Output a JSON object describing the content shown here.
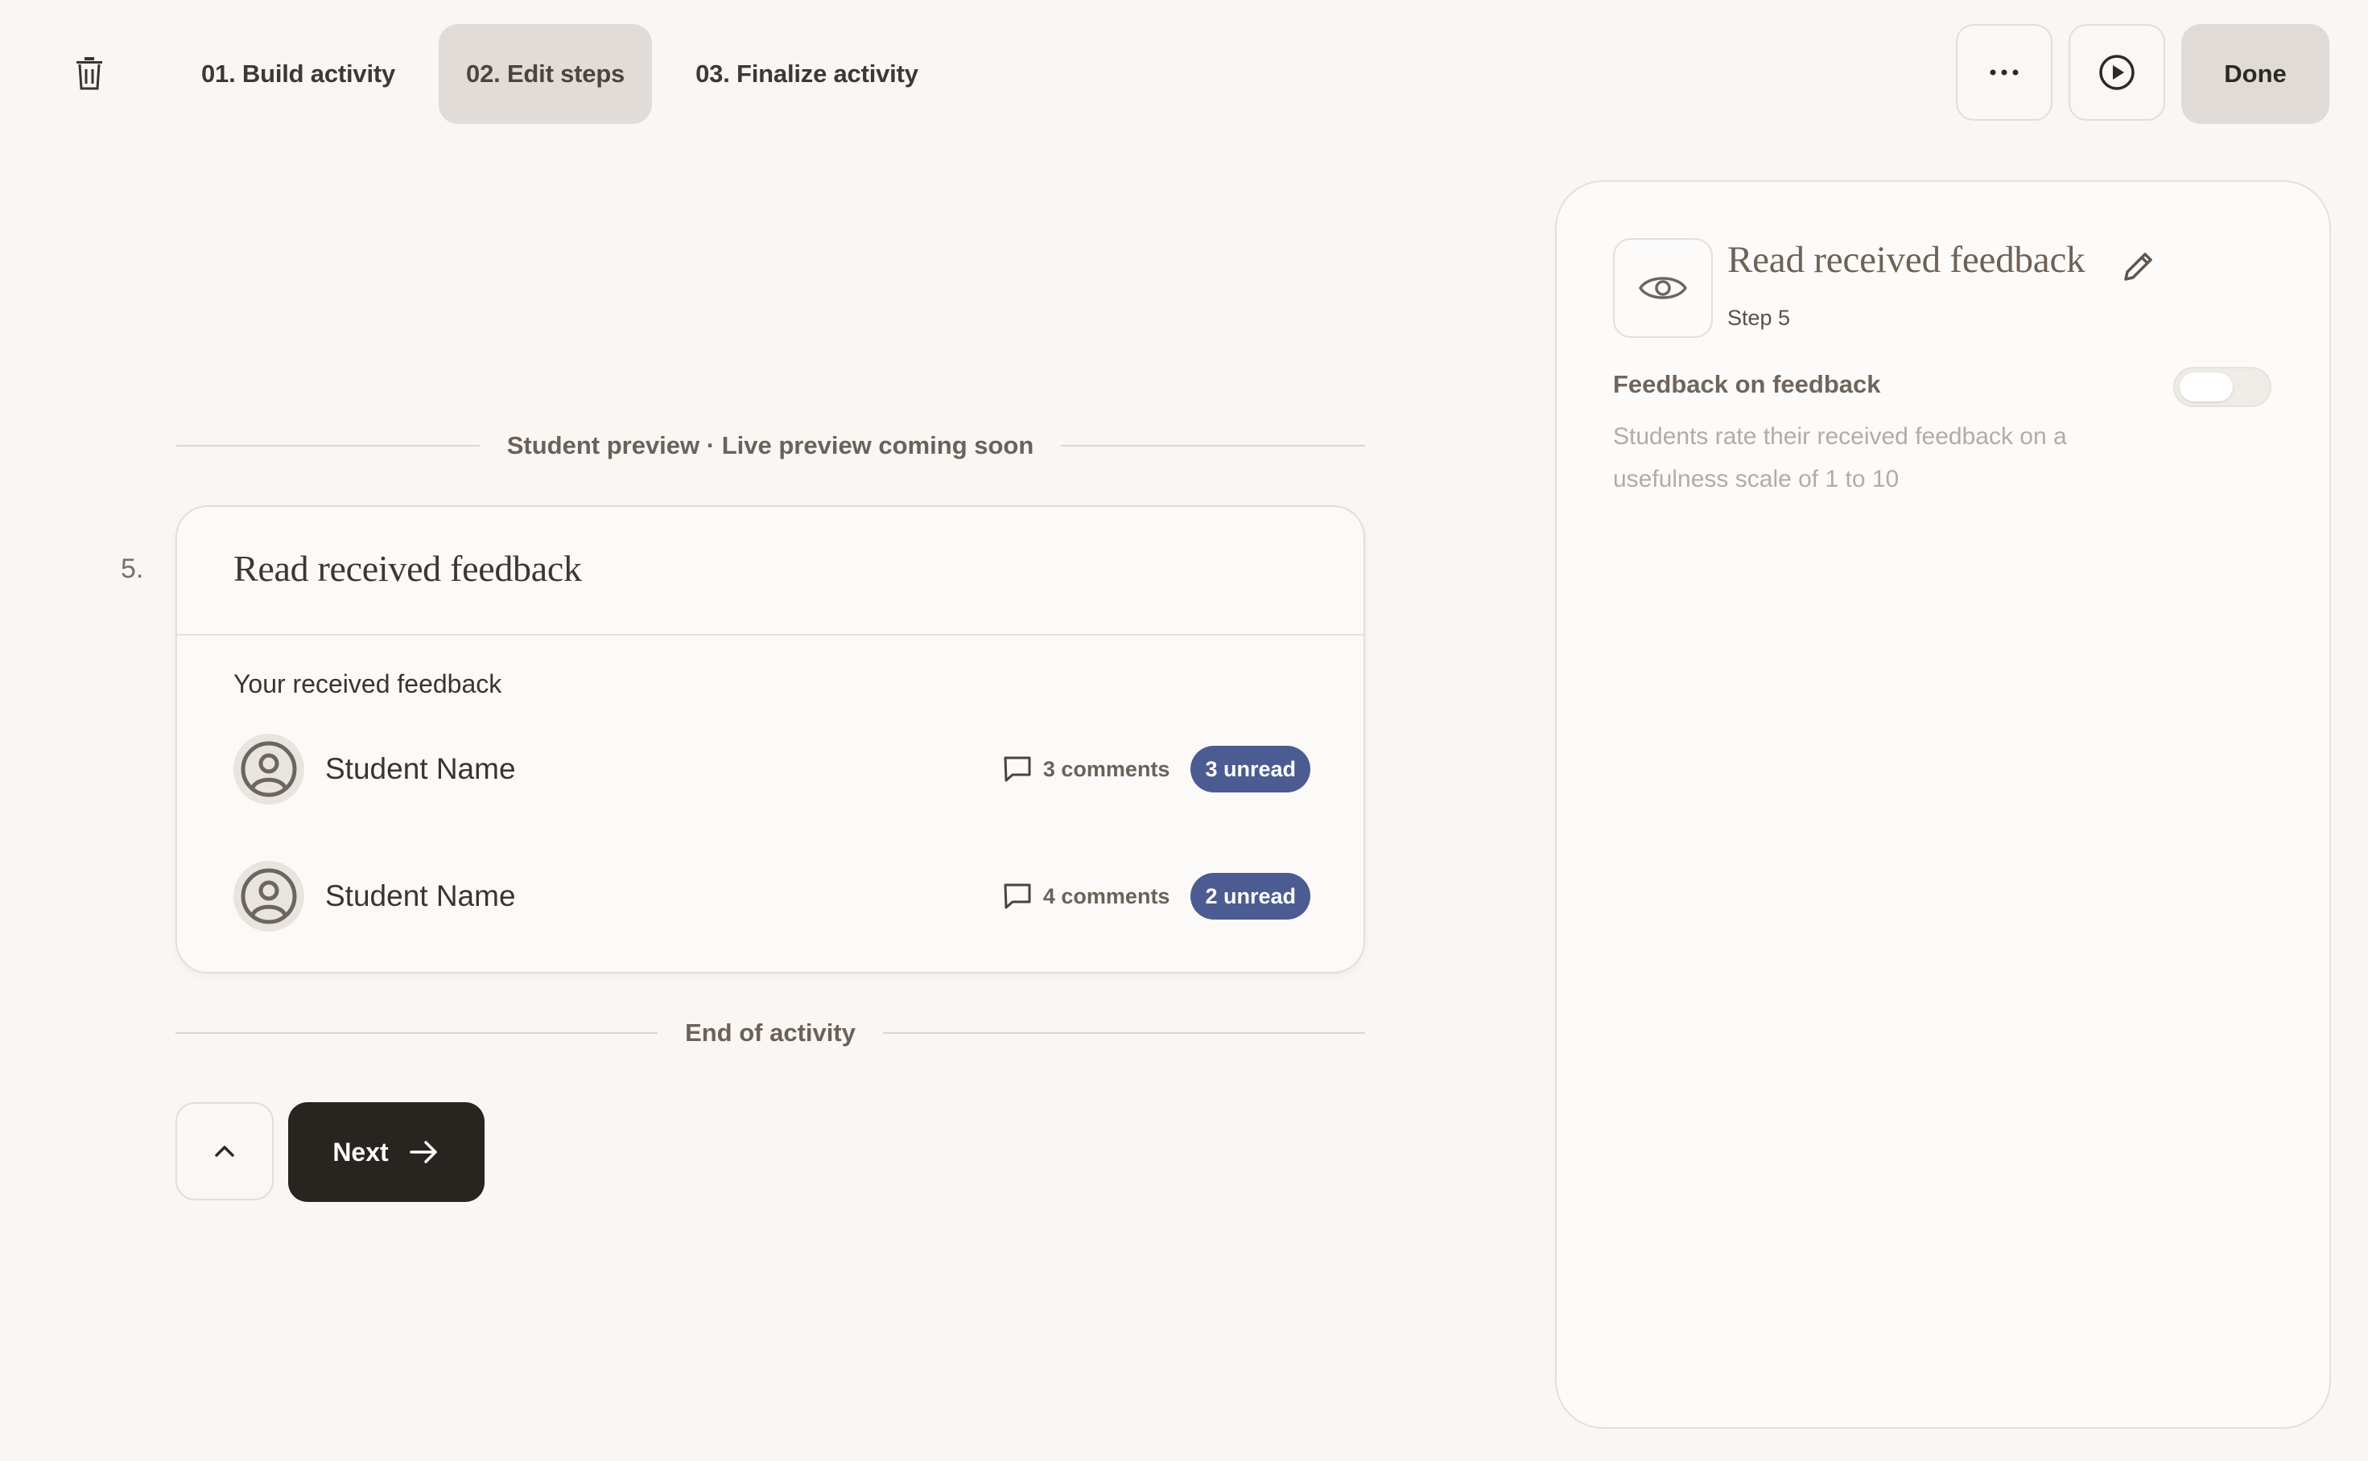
{
  "header": {
    "tabs": [
      {
        "label": "01. Build activity",
        "active": false
      },
      {
        "label": "02. Edit steps",
        "active": true
      },
      {
        "label": "03. Finalize activity",
        "active": false
      }
    ],
    "more_icon": "ellipsis-icon",
    "play_icon": "play-circle-icon",
    "done_label": "Done",
    "delete_icon": "trash-icon"
  },
  "preview": {
    "divider_label": "Student preview · Live preview coming soon",
    "step_number": "5.",
    "card": {
      "title": "Read received feedback",
      "subtitle": "Your received feedback",
      "students": [
        {
          "name": "Student Name",
          "comments": "3 comments",
          "unread": "3 unread"
        },
        {
          "name": "Student Name",
          "comments": "4 comments",
          "unread": "2 unread"
        }
      ]
    },
    "end_label": "End of activity",
    "next_label": "Next"
  },
  "panel": {
    "icon": "eye-icon",
    "title": "Read received feedback",
    "step": "Step 5",
    "setting_label": "Feedback on feedback",
    "setting_enabled": false,
    "setting_description": "Students rate their received feedback on a usefulness scale of 1 to 10"
  },
  "colors": {
    "background": "#f9f6f3",
    "badge": "#4c5b92",
    "primary_button": "#28241f"
  }
}
